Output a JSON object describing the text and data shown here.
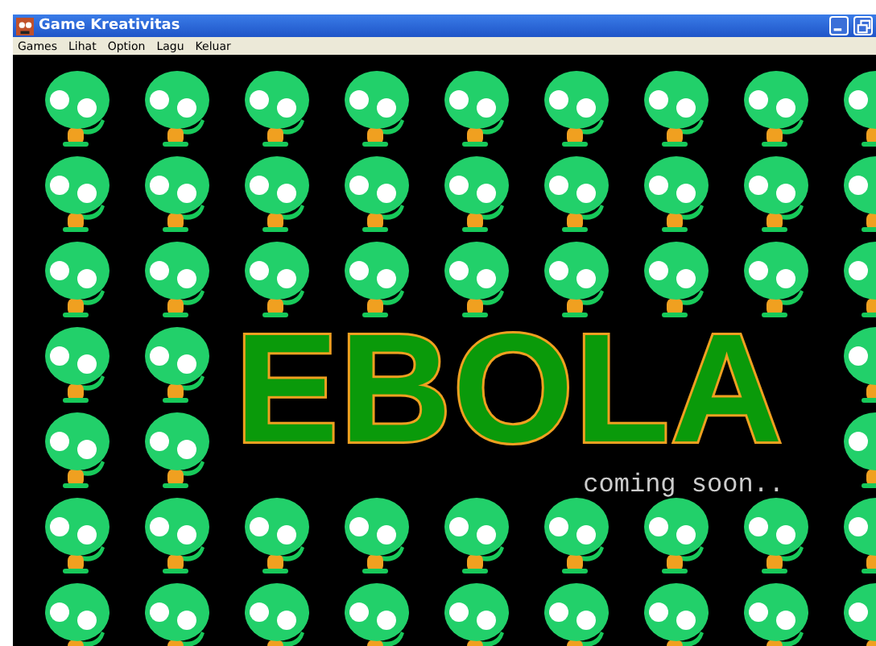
{
  "window": {
    "title": "Game Kreativitas"
  },
  "menu": [
    "Games",
    "Lihat",
    "Option",
    "Lagu",
    "Keluar"
  ],
  "splash": {
    "title": "EBOLA",
    "subtitle": "coming soon.."
  }
}
